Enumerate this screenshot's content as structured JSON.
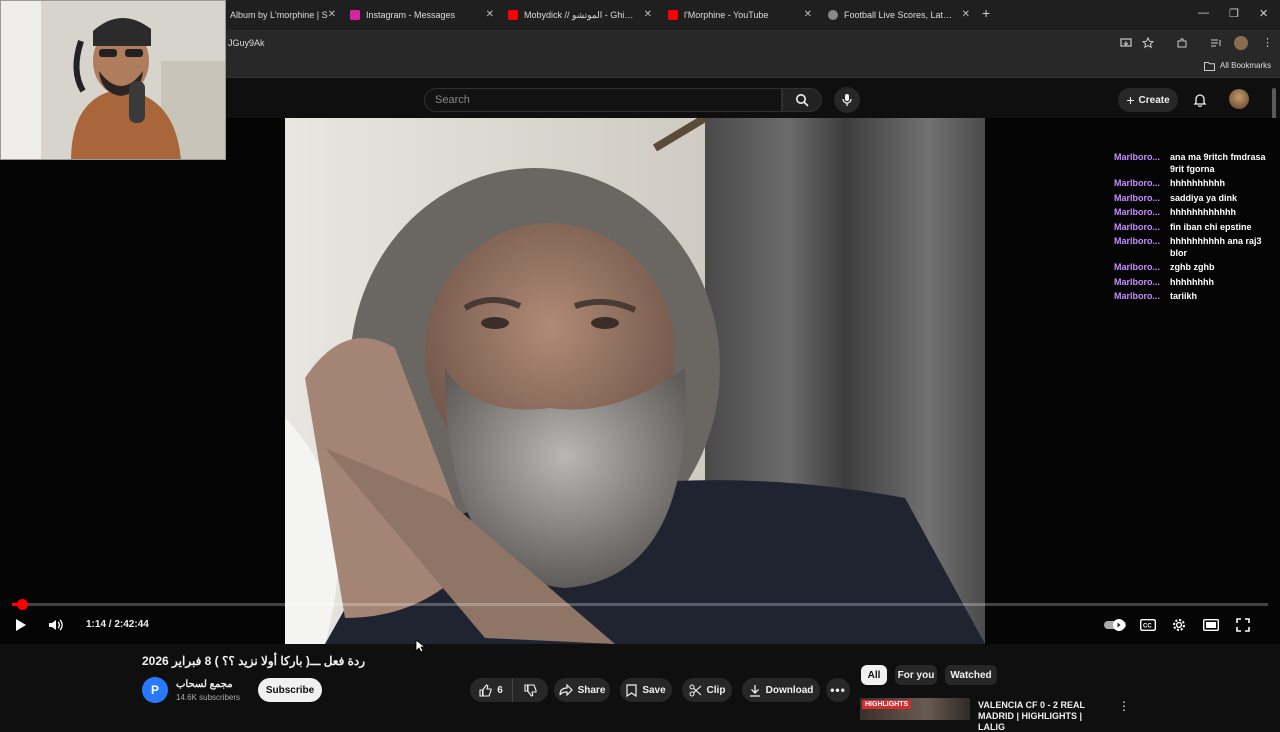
{
  "browser": {
    "tabs": [
      {
        "title": "Album by L'morphine | S",
        "favicon_color": "#1db954"
      },
      {
        "title": "Instagram - Messages",
        "favicon_color": "#d6249f"
      },
      {
        "title": "Mobydick // الموتشو - Ghir bar",
        "favicon_color": "#ff0000"
      },
      {
        "title": "l'Morphine - YouTube",
        "favicon_color": "#ff0000"
      },
      {
        "title": "Football Live Scores, Latest Foo",
        "favicon_color": "#888888"
      }
    ],
    "new_tab": "+",
    "address_fragment": "JGuy9Ak",
    "bookmarks_label": "All Bookmarks",
    "window_controls": [
      "—",
      "❐",
      "✕"
    ]
  },
  "youtube": {
    "search_placeholder": "Search",
    "create_label": "Create",
    "accent": "#ff0000"
  },
  "chat": [
    {
      "author": "Marlboro...",
      "text": "ana ma 9ritch fmdrasa 9rit fgorna"
    },
    {
      "author": "Marlboro...",
      "text": "hhhhhhhhhh"
    },
    {
      "author": "Marlboro...",
      "text": "saddiya ya dink"
    },
    {
      "author": "Marlboro...",
      "text": "hhhhhhhhhhhh"
    },
    {
      "author": "Marlboro...",
      "text": "fin iban chi epstine"
    },
    {
      "author": "Marlboro...",
      "text": "hhhhhhhhhh ana raj3 blor"
    },
    {
      "author": "Marlboro...",
      "text": "zghb zghb"
    },
    {
      "author": "Marlboro...",
      "text": "hhhhhhhh"
    },
    {
      "author": "Marlboro...",
      "text": "tariikh"
    }
  ],
  "player": {
    "time_display": "1:14 / 2:42:44",
    "progress_fraction": 0.0076
  },
  "video": {
    "title": "ردة فعل ـــ( باركا أولا نزيد ؟؟ ) 8 فبراير 2026",
    "channel_name": "مجمع لسحاب",
    "channel_initial": "P",
    "subscribers": "14.6K subscribers",
    "subscribe_label": "Subscribe",
    "likes": "6",
    "share_label": "Share",
    "save_label": "Save",
    "clip_label": "Clip",
    "download_label": "Download"
  },
  "recommendations": {
    "chips": [
      "All",
      "For you",
      "Watched"
    ],
    "first_title": "VALENCIA CF 0 - 2 REAL MADRID | HIGHLIGHTS | LALIG",
    "first_badge": "HIGHLIGHTS"
  }
}
